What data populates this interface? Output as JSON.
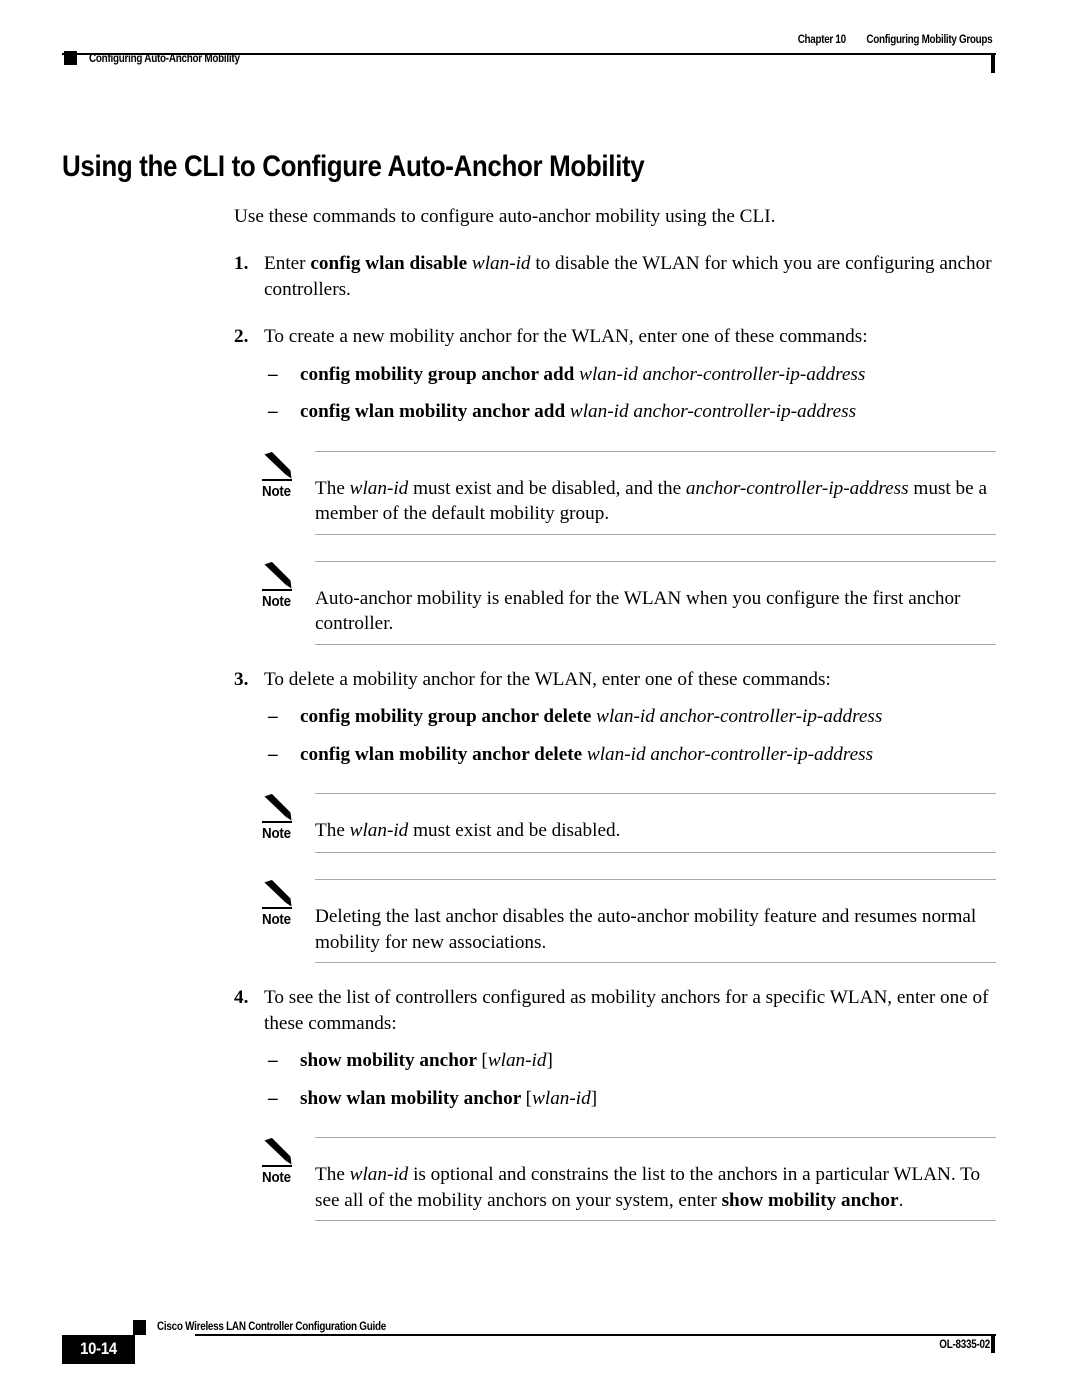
{
  "header": {
    "left_title": "Configuring Auto-Anchor Mobility",
    "chapter_number": "Chapter 10",
    "chapter_title": "Configuring Mobility Groups"
  },
  "page_title": "Using the CLI to Configure Auto-Anchor Mobility",
  "intro": "Use these commands to configure auto-anchor mobility using the CLI.",
  "note_label": "Note",
  "blocks": [
    {
      "kind": "step",
      "number": "1.",
      "parts": [
        {
          "style": "normal",
          "text": "Enter "
        },
        {
          "style": "bold",
          "text": "config wlan disable"
        },
        {
          "style": "normal",
          "text": " "
        },
        {
          "style": "italic",
          "text": "wlan-id"
        },
        {
          "style": "normal",
          "text": " to disable the WLAN for which you are configuring anchor controllers."
        }
      ]
    },
    {
      "kind": "step",
      "number": "2.",
      "parts": [
        {
          "style": "normal",
          "text": "To create a new mobility anchor for the WLAN, enter one of these commands:"
        }
      ]
    },
    {
      "kind": "subcmd",
      "dash": "–",
      "command": "config mobility group anchor add",
      "args": "wlan-id anchor-controller-ip-address",
      "bracket_open": "",
      "bracket_close": ""
    },
    {
      "kind": "subcmd",
      "dash": "–",
      "command": "config wlan mobility anchor add",
      "args": "wlan-id anchor-controller-ip-address",
      "bracket_open": "",
      "bracket_close": ""
    },
    {
      "kind": "note",
      "parts": [
        {
          "style": "normal",
          "text": "The "
        },
        {
          "style": "italic",
          "text": "wlan-id"
        },
        {
          "style": "normal",
          "text": " must exist and be disabled, and the "
        },
        {
          "style": "italic",
          "text": "anchor-controller-ip-address"
        },
        {
          "style": "normal",
          "text": " must be a member of the default mobility group."
        }
      ]
    },
    {
      "kind": "note",
      "parts": [
        {
          "style": "normal",
          "text": "Auto-anchor mobility is enabled for the WLAN when you configure the first anchor controller."
        }
      ]
    },
    {
      "kind": "step",
      "number": "3.",
      "parts": [
        {
          "style": "normal",
          "text": "To delete a mobility anchor for the WLAN, enter one of these commands:"
        }
      ]
    },
    {
      "kind": "subcmd",
      "dash": "–",
      "command": "config mobility group anchor delete",
      "args": "wlan-id anchor-controller-ip-address",
      "bracket_open": "",
      "bracket_close": ""
    },
    {
      "kind": "subcmd",
      "dash": "–",
      "command": "config wlan mobility anchor delete",
      "args": "wlan-id anchor-controller-ip-address",
      "bracket_open": "",
      "bracket_close": ""
    },
    {
      "kind": "note",
      "parts": [
        {
          "style": "normal",
          "text": "The "
        },
        {
          "style": "italic",
          "text": "wlan-id"
        },
        {
          "style": "normal",
          "text": " must exist and be disabled."
        }
      ]
    },
    {
      "kind": "note",
      "parts": [
        {
          "style": "normal",
          "text": "Deleting the last anchor disables the auto-anchor mobility feature and resumes normal mobility for new associations."
        }
      ]
    },
    {
      "kind": "step",
      "number": "4.",
      "parts": [
        {
          "style": "normal",
          "text": "To see the list of controllers configured as mobility anchors for a specific WLAN, enter one of these commands:"
        }
      ]
    },
    {
      "kind": "subcmd",
      "dash": "–",
      "command": "show mobility anchor",
      "args": "wlan-id",
      "bracket_open": "[",
      "bracket_close": "]"
    },
    {
      "kind": "subcmd",
      "dash": "–",
      "command": "show wlan mobility anchor",
      "args": "wlan-id",
      "bracket_open": "[",
      "bracket_close": "]"
    },
    {
      "kind": "note",
      "parts": [
        {
          "style": "normal",
          "text": "The "
        },
        {
          "style": "italic",
          "text": "wlan-id"
        },
        {
          "style": "normal",
          "text": " is optional and constrains the list to the anchors in a particular WLAN. To see all of the mobility anchors on your system, enter "
        },
        {
          "style": "bold",
          "text": "show mobility anchor"
        },
        {
          "style": "normal",
          "text": "."
        }
      ]
    }
  ],
  "footer": {
    "page_number": "10-14",
    "guide_title": "Cisco Wireless LAN Controller Configuration Guide",
    "doc_id": "OL-8335-02"
  },
  "spacing": {
    "intro_gap": 22,
    "step_gap": 22,
    "subcmd_gap": 12,
    "note_gap": 26
  }
}
